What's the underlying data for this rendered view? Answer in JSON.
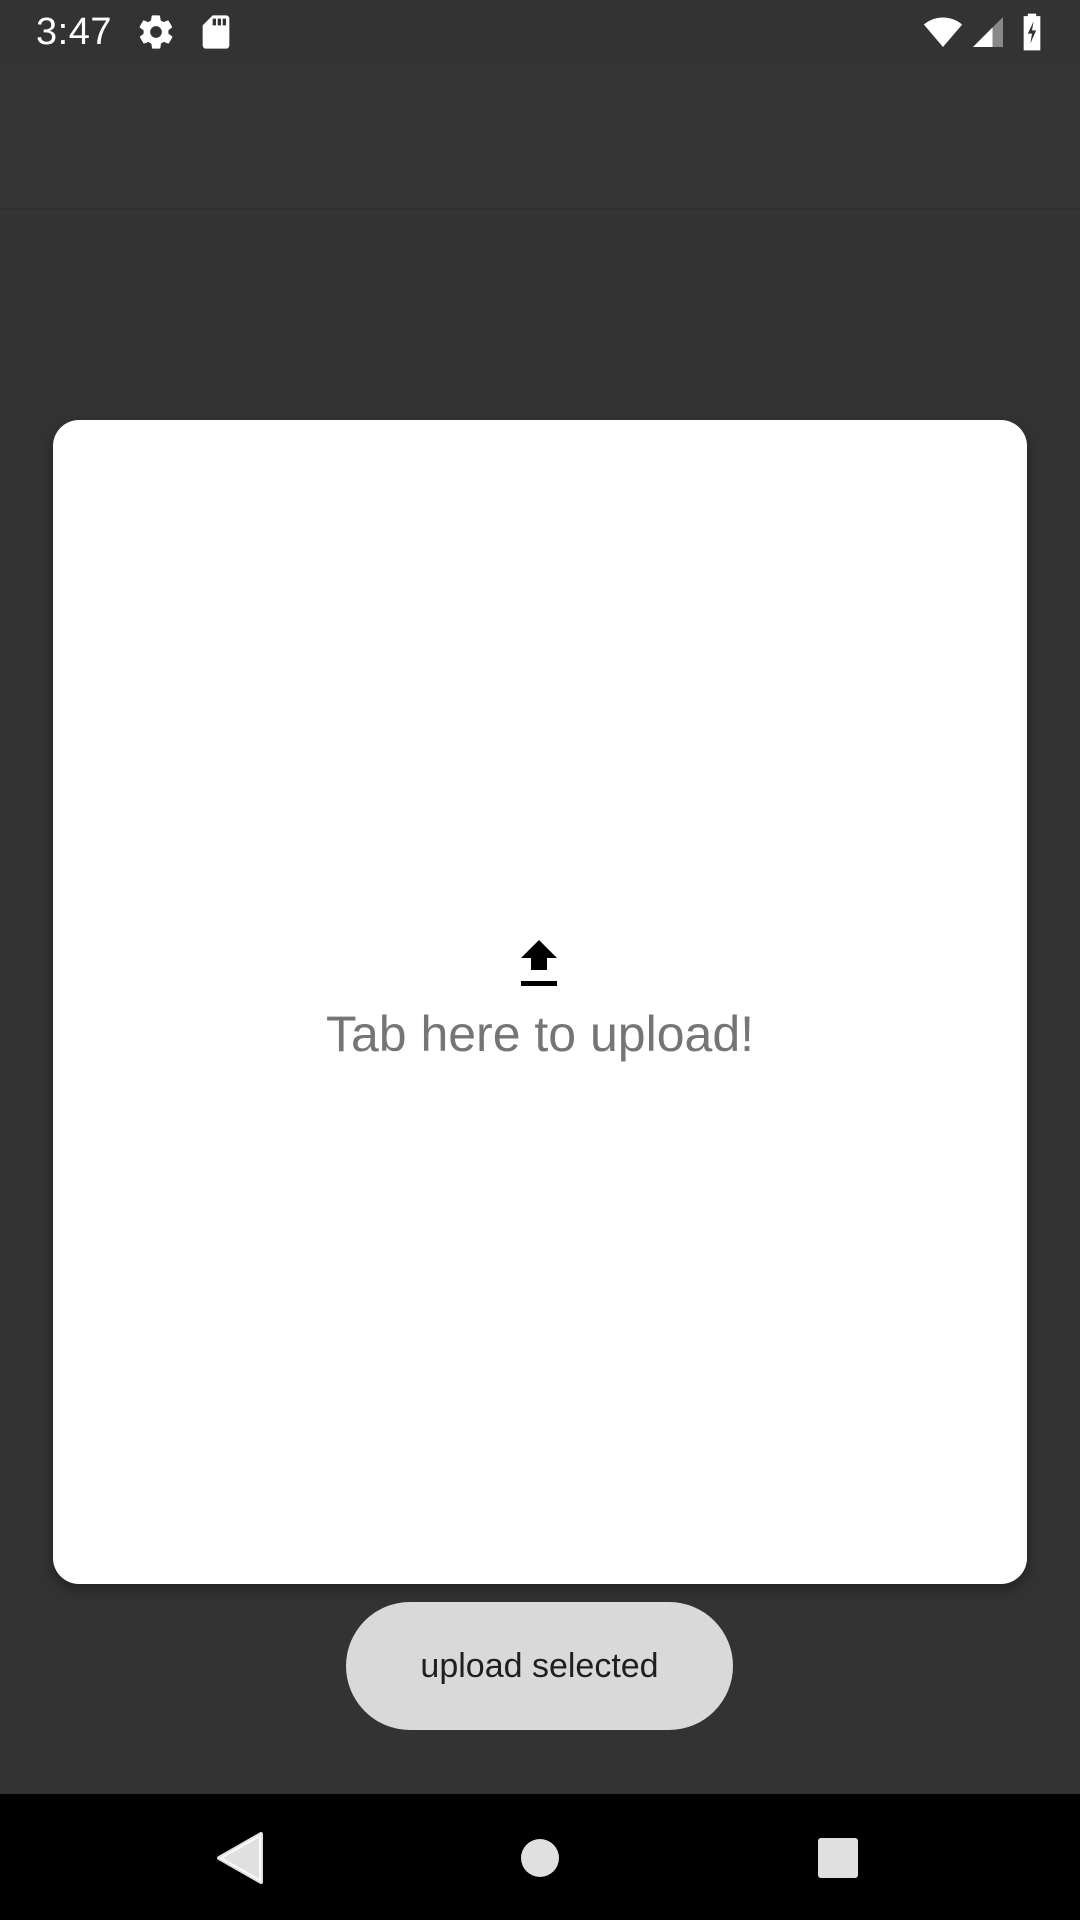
{
  "status_bar": {
    "time": "3:47",
    "icons": [
      "gear-icon",
      "sd-card-icon",
      "wifi-icon",
      "cell-signal-icon",
      "battery-charging-icon"
    ]
  },
  "upload_area": {
    "icon": "upload-icon",
    "hint": "Tab here to upload!"
  },
  "actions": {
    "upload_selected_label": "upload selected"
  },
  "nav_bar": {
    "icons": [
      "back-icon",
      "home-icon",
      "recents-icon"
    ]
  },
  "colors": {
    "background": "#333333",
    "card": "#ffffff",
    "hint_text": "#757575",
    "button_bg": "#d9d9d9",
    "nav_bar": "#000000"
  }
}
